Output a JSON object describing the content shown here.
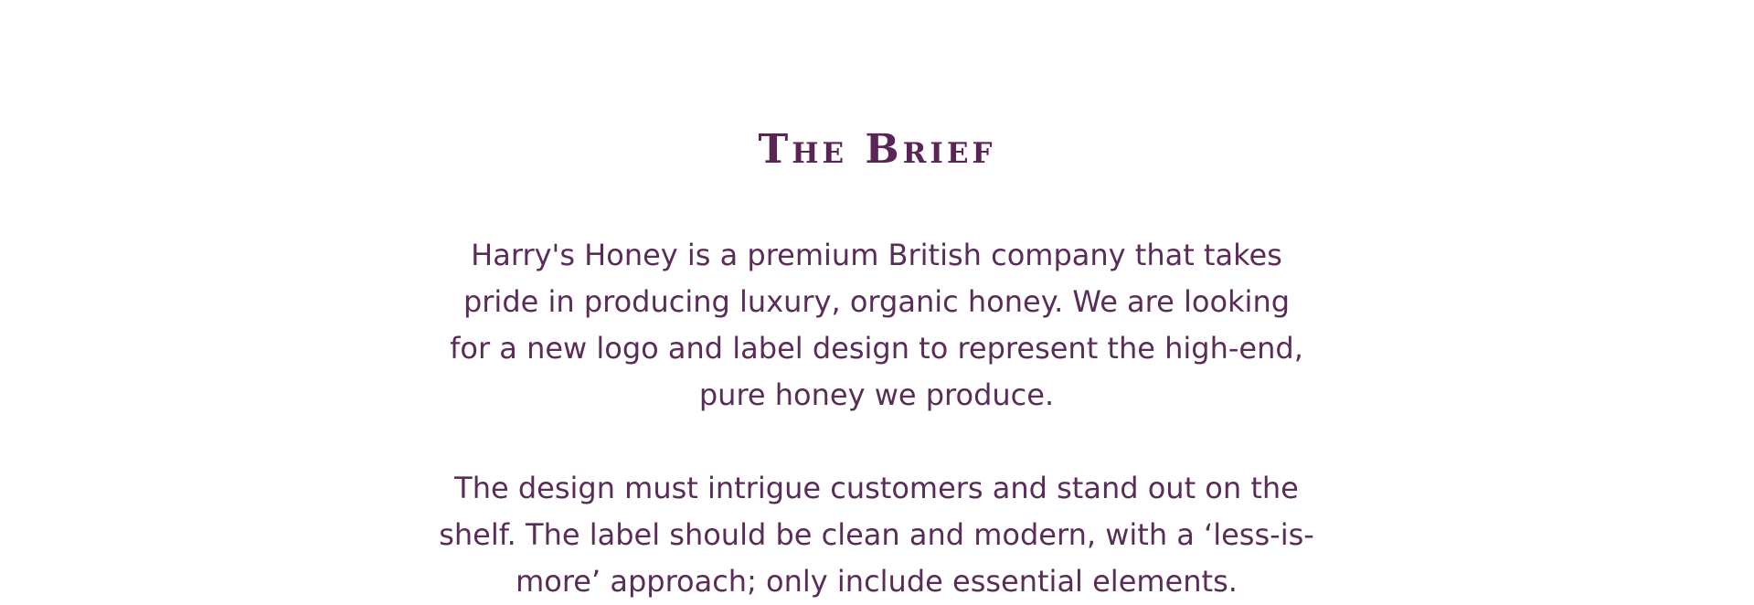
{
  "brief": {
    "title": "The Brief",
    "paragraph1": {
      "lines": [
        "Harry's Honey is a premium British company that takes",
        "pride in producing luxury, organic honey. We are looking",
        "for a new logo and label design to represent the high-end,",
        "pure honey we produce."
      ]
    },
    "paragraph2": {
      "lines": [
        "The design must intrigue customers and stand out on the",
        "shelf. The label should be clean and modern, with a ‘less-is-",
        "more’ approach; only include essential elements."
      ]
    }
  },
  "colors": {
    "heading": "#5a2456",
    "text": "#5a2c58",
    "background": "#ffffff"
  }
}
